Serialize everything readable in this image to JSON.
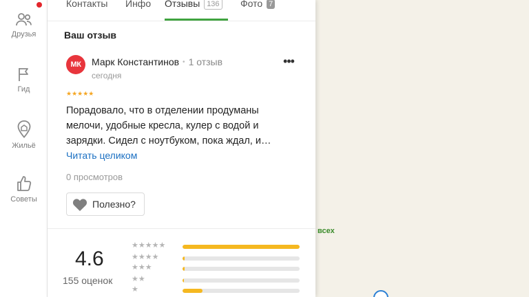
{
  "rail": {
    "items": [
      {
        "label": "Друзья",
        "icon": "people-icon",
        "notification": true
      },
      {
        "label": "Гид",
        "icon": "flag-icon"
      },
      {
        "label": "Жильё",
        "icon": "place-icon"
      },
      {
        "label": "Советы",
        "icon": "thumbs-up-icon"
      }
    ]
  },
  "tabs": [
    {
      "label": "Контакты"
    },
    {
      "label": "Инфо"
    },
    {
      "label": "Отзывы",
      "count": "136",
      "active": true
    },
    {
      "label": "Фото",
      "count": "7"
    }
  ],
  "review": {
    "section_title": "Ваш отзыв",
    "avatar_initials": "МК",
    "author": "Марк Константинов",
    "separator": "•",
    "reviews_count": "1 отзыв",
    "date": "сегодня",
    "more": "•••",
    "rating_stars": 5,
    "stars_display": "★★★★★",
    "text": "Порадовало, что в отделении продуманы мелочи, удобные кресла, кулер с водой и зарядки. Сидел с ноутбуком, пока ждал, и…",
    "read_more": "Читать целиком",
    "views": "0 просмотров",
    "useful_label": "Полезно?"
  },
  "summary": {
    "rating": "4.6",
    "ratings_count": "155 оценок",
    "distribution": [
      {
        "stars": "★★★★★",
        "share": 1.0
      },
      {
        "stars": "★★★★",
        "share": 0.02
      },
      {
        "stars": "★★★",
        "share": 0.02
      },
      {
        "stars": "★★",
        "share": 0.01
      },
      {
        "stars": "★",
        "share": 0.17
      }
    ]
  },
  "map": {
    "label": "всех"
  },
  "colors": {
    "accent_green": "#3fa33f",
    "star_orange": "#f5a623",
    "bar_yellow": "#f5b820",
    "link_blue": "#1a6fc2",
    "notification_red": "#e3262c"
  }
}
